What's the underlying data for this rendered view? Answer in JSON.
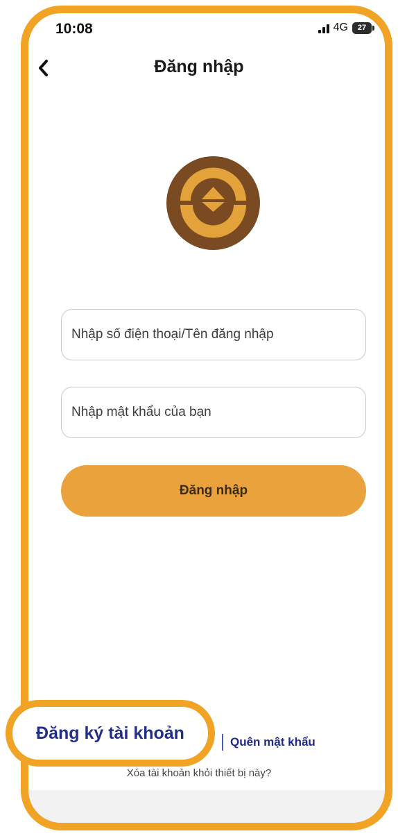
{
  "status_bar": {
    "time": "10:08",
    "network": "4G",
    "battery": "27"
  },
  "header": {
    "back_icon": "chevron-left-icon",
    "title": "Đăng nhập"
  },
  "logo": {
    "icon": "gold-coin-logo",
    "colors": {
      "outer": "#7a4a22",
      "inner": "#e3a33a"
    }
  },
  "form": {
    "username_placeholder": "Nhập số điện thoại/Tên đăng nhập",
    "password_placeholder": "Nhập mật khẩu của bạn",
    "login_label": "Đăng nhập"
  },
  "links": {
    "register": "Đăng ký tài khoản",
    "forgot_password": "Quên mật khẩu",
    "remove_account": "Xóa tài khoản khỏi thiết bị này?"
  },
  "colors": {
    "accent": "#f0a324",
    "button": "#eaa23c",
    "link": "#232e86"
  }
}
